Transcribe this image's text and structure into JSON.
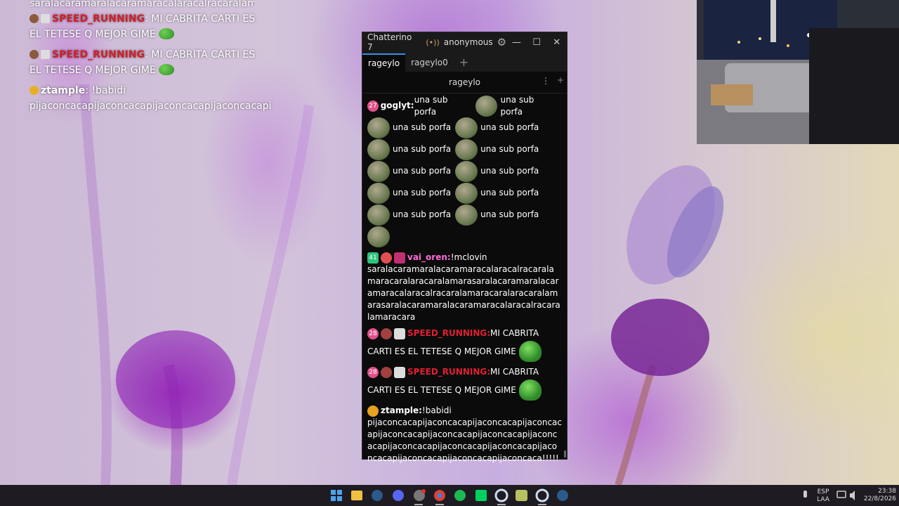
{
  "overlay": {
    "top_line": "saralacaramaralacaramaracalaracalracaralamarac",
    "msg1": {
      "user": "SPEED_RUNNING",
      "text_a": ": MI CABRITA CARTI ES",
      "text_b": "EL TETESE Q MEJOR GIME"
    },
    "msg2": {
      "user": "SPEED_RUNNING",
      "text_a": ": MI CABRITA CARTI ES",
      "text_b": "EL TETESE Q MEJOR GIME"
    },
    "msg3": {
      "user": "ztample",
      "text_a": ": !babidi",
      "text_b": "pijaconcacapijaconcacapijaconcacapijaconcacapi"
    }
  },
  "window": {
    "title": "Chatterino 7",
    "live_icon": "(•))",
    "account": "anonymous",
    "min": "—",
    "max": "☐",
    "close": "✕",
    "tabs": [
      {
        "label": "rageylo"
      },
      {
        "label": "rageylo0"
      }
    ],
    "tab_add": "+",
    "channel": "rageylo",
    "menu": "⋮",
    "split_add": "+"
  },
  "chat": {
    "m1": {
      "badge": "27",
      "user": "goglyt:",
      "text": " una sub porfa",
      "text2": "una sub porfa"
    },
    "sub": "una sub porfa",
    "m2": {
      "badge": "41",
      "user": "vai_oren:",
      "text": " !mclovin",
      "body": "saralacaramaralacaramaracalaracalracaralamaracaralaracaralamarasaralacaramaralacaramaracalaracalracaralamaracaralaracaralamarasaralacaramaralacaramaracalaracalracaralamaracara"
    },
    "m3": {
      "badge": "28",
      "user": "SPEED_RUNNING:",
      "text": " MI CABRITA",
      "text2": "CARTI ES EL TETESE Q MEJOR GIME"
    },
    "m4": {
      "badge": "28",
      "user": "SPEED_RUNNING:",
      "text": " MI CABRITA",
      "text2": "CARTI ES EL TETESE Q MEJOR GIME"
    },
    "m5": {
      "user": "ztample:",
      "text": " !babidi",
      "body": "pijaconcacapijaconcacapijaconcacapijaconcacapijaconcacapijaconcacapijaconcacapijaconcacapijaconcacapijaconcacapijaconcacapijaconcacapijaconcacapijaconcacapijaconcaca!!!!!"
    }
  },
  "taskbar": {
    "lang": "ESP",
    "layout": "LAA",
    "time": "23:38",
    "date": "22/8/2026"
  }
}
